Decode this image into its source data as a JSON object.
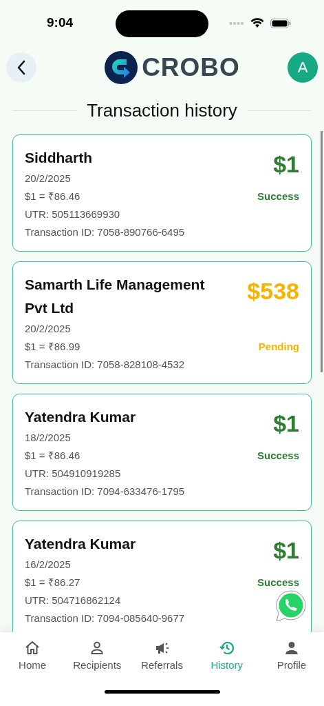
{
  "status_bar": {
    "time": "9:04"
  },
  "header": {
    "logo_text": "CROBO",
    "avatar_initial": "A"
  },
  "title": "Transaction history",
  "transactions": [
    {
      "name": "Siddharth",
      "date": "20/2/2025",
      "rate": "$1 = ₹86.46",
      "utr": "UTR: 505113669930",
      "transaction_id": "Transaction ID: 7058-890766-6495",
      "amount": "$1",
      "status": "Success",
      "kind": "success"
    },
    {
      "name": "Samarth Life Management Pvt Ltd",
      "date": "20/2/2025",
      "rate": "$1 = ₹86.99",
      "transaction_id": "Transaction ID: 7058-828108-4532",
      "amount": "$538",
      "status": "Pending",
      "kind": "pending"
    },
    {
      "name": "Yatendra Kumar",
      "date": "18/2/2025",
      "rate": "$1 = ₹86.46",
      "utr": "UTR: 504910919285",
      "transaction_id": "Transaction ID: 7094-633476-1795",
      "amount": "$1",
      "status": "Success",
      "kind": "success"
    },
    {
      "name": "Yatendra Kumar",
      "date": "16/2/2025",
      "rate": "$1 = ₹86.27",
      "utr": "UTR: 504716862124",
      "transaction_id": "Transaction ID: 7094-085640-9677",
      "amount": "$1",
      "status": "Success",
      "kind": "success"
    }
  ],
  "tabs": [
    {
      "label": "Home",
      "kind": "home",
      "selected": false
    },
    {
      "label": "Recipients",
      "kind": "recipients",
      "selected": false
    },
    {
      "label": "Referrals",
      "kind": "referrals",
      "selected": false
    },
    {
      "label": "History",
      "kind": "history",
      "selected": true
    },
    {
      "label": "Profile",
      "kind": "profile",
      "selected": false
    }
  ]
}
